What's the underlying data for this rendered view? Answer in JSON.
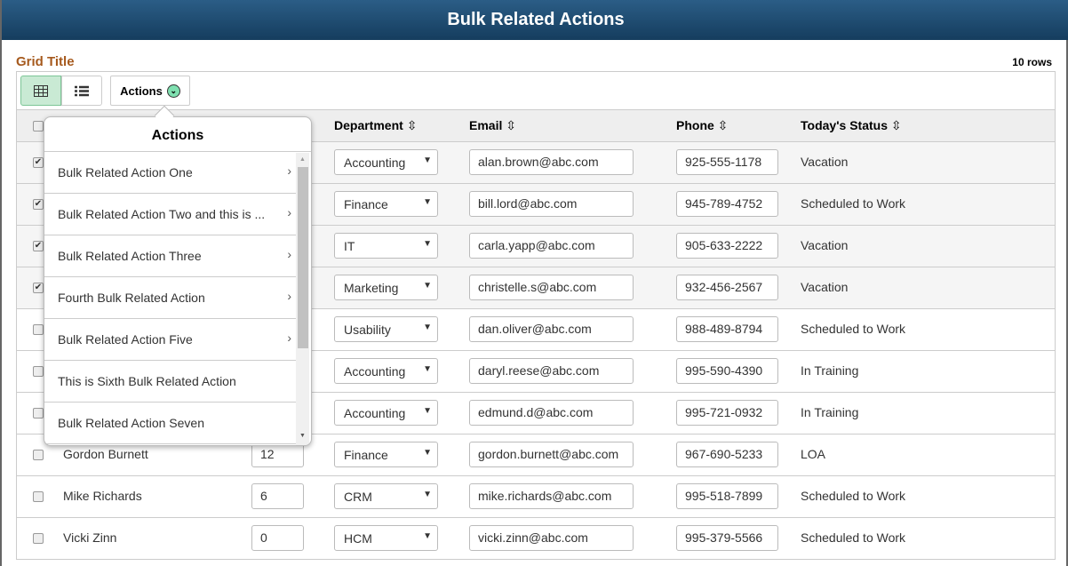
{
  "title": "Bulk Related Actions",
  "grid_title": "Grid Title",
  "row_count": "10 rows",
  "toolbar": {
    "actions_label": "Actions"
  },
  "columns": {
    "department": "Department",
    "email": "Email",
    "phone": "Phone",
    "status": "Today's Status"
  },
  "sort_icon": "⇳",
  "rows": [
    {
      "checked": true,
      "name": "",
      "num": "",
      "dept": "Accounting",
      "email": "alan.brown@abc.com",
      "phone": "925-555-1178",
      "status": "Vacation"
    },
    {
      "checked": true,
      "name": "",
      "num": "",
      "dept": "Finance",
      "email": "bill.lord@abc.com",
      "phone": "945-789-4752",
      "status": "Scheduled to Work"
    },
    {
      "checked": true,
      "name": "",
      "num": "",
      "dept": "IT",
      "email": "carla.yapp@abc.com",
      "phone": "905-633-2222",
      "status": "Vacation"
    },
    {
      "checked": true,
      "name": "",
      "num": "",
      "dept": "Marketing",
      "email": "christelle.s@abc.com",
      "phone": "932-456-2567",
      "status": "Vacation"
    },
    {
      "checked": false,
      "name": "",
      "num": "",
      "dept": "Usability",
      "email": "dan.oliver@abc.com",
      "phone": "988-489-8794",
      "status": "Scheduled to Work"
    },
    {
      "checked": false,
      "name": "",
      "num": "",
      "dept": "Accounting",
      "email": "daryl.reese@abc.com",
      "phone": "995-590-4390",
      "status": "In Training"
    },
    {
      "checked": false,
      "name": "",
      "num": "",
      "dept": "Accounting",
      "email": "edmund.d@abc.com",
      "phone": "995-721-0932",
      "status": "In Training"
    },
    {
      "checked": false,
      "name": "Gordon Burnett",
      "num": "12",
      "dept": "Finance",
      "email": "gordon.burnett@abc.com",
      "phone": "967-690-5233",
      "status": "LOA"
    },
    {
      "checked": false,
      "name": "Mike Richards",
      "num": "6",
      "dept": "CRM",
      "email": "mike.richards@abc.com",
      "phone": "995-518-7899",
      "status": "Scheduled to Work"
    },
    {
      "checked": false,
      "name": "Vicki Zinn",
      "num": "0",
      "dept": "HCM",
      "email": "vicki.zinn@abc.com",
      "phone": "995-379-5566",
      "status": "Scheduled to Work"
    }
  ],
  "popup": {
    "title": "Actions",
    "items": [
      {
        "label": "Bulk Related Action One",
        "submenu": true
      },
      {
        "label": "Bulk Related Action Two and this is ...",
        "submenu": true
      },
      {
        "label": "Bulk Related Action Three",
        "submenu": true
      },
      {
        "label": "Fourth Bulk Related Action",
        "submenu": true
      },
      {
        "label": "Bulk Related Action Five",
        "submenu": true
      },
      {
        "label": "This is Sixth Bulk Related Action",
        "submenu": false
      },
      {
        "label": "Bulk Related Action Seven",
        "submenu": false
      }
    ]
  },
  "colors": {
    "title_bar": "#1f4d73",
    "grid_title": "#a65a1e",
    "active_view": "#c9ead4"
  }
}
